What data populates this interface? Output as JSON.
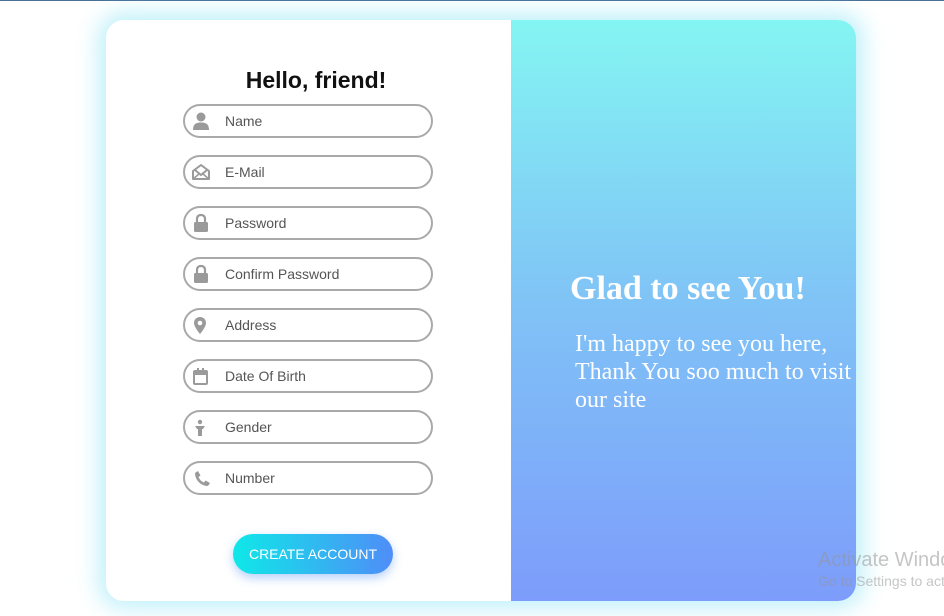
{
  "form": {
    "title": "Hello, friend!",
    "fields": [
      {
        "placeholder": "Name",
        "icon": "user-icon"
      },
      {
        "placeholder": "E-Mail",
        "icon": "envelope-open-icon"
      },
      {
        "placeholder": "Password",
        "icon": "lock-icon"
      },
      {
        "placeholder": "Confirm Password",
        "icon": "lock-icon"
      },
      {
        "placeholder": "Address",
        "icon": "map-pin-icon"
      },
      {
        "placeholder": "Date Of Birth",
        "icon": "calendar-icon"
      },
      {
        "placeholder": "Gender",
        "icon": "person-icon"
      },
      {
        "placeholder": "Number",
        "icon": "phone-icon"
      }
    ],
    "submit_label": "CREATE ACCOUNT"
  },
  "welcome": {
    "title": "Glad to see You!",
    "message": "I'm happy to see you here, Thank You soo much to visit our site"
  },
  "watermark": {
    "title": "Activate Windows",
    "subtitle": "Go to Settings to activate Windows."
  },
  "colors": {
    "accent_gradient_start": "#0fe8e8",
    "accent_gradient_end": "#4f8df8",
    "panel_gradient_top": "#84f5f2",
    "panel_gradient_bottom": "#7d9cfb",
    "field_border": "#a9a9a9",
    "icon_gray": "#9a9a9a"
  }
}
